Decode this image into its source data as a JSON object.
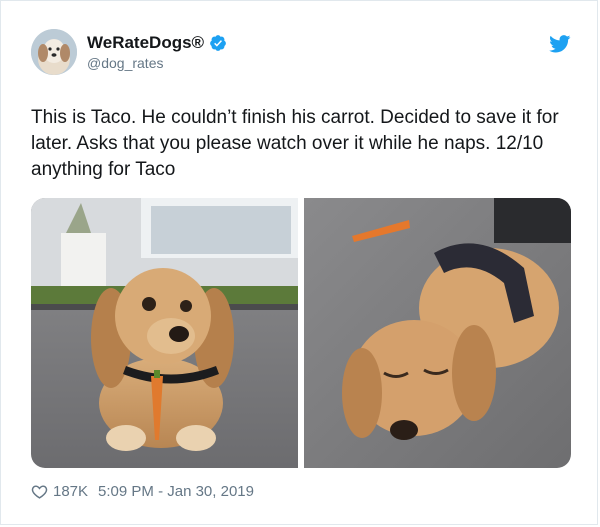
{
  "account": {
    "display_name": "WeRateDogs®",
    "handle": "@dog_rates",
    "verified_icon": "verified-badge-icon",
    "platform_icon": "twitter-bird-icon"
  },
  "tweet": {
    "text": "This is Taco. He couldn’t finish his carrot. Decided to save it for later. Asks that you please watch over it while he naps. 12/10 anything for Taco"
  },
  "media": {
    "photos": [
      "puppy-with-carrot-photo",
      "puppy-sleeping-photo"
    ]
  },
  "footer": {
    "likes": "187K",
    "timestamp": "5:09 PM - Jan 30, 2019"
  },
  "colors": {
    "twitter_blue": "#1da1f2",
    "text_primary": "#14171a",
    "text_secondary": "#657786",
    "border": "#e1e8ed"
  }
}
